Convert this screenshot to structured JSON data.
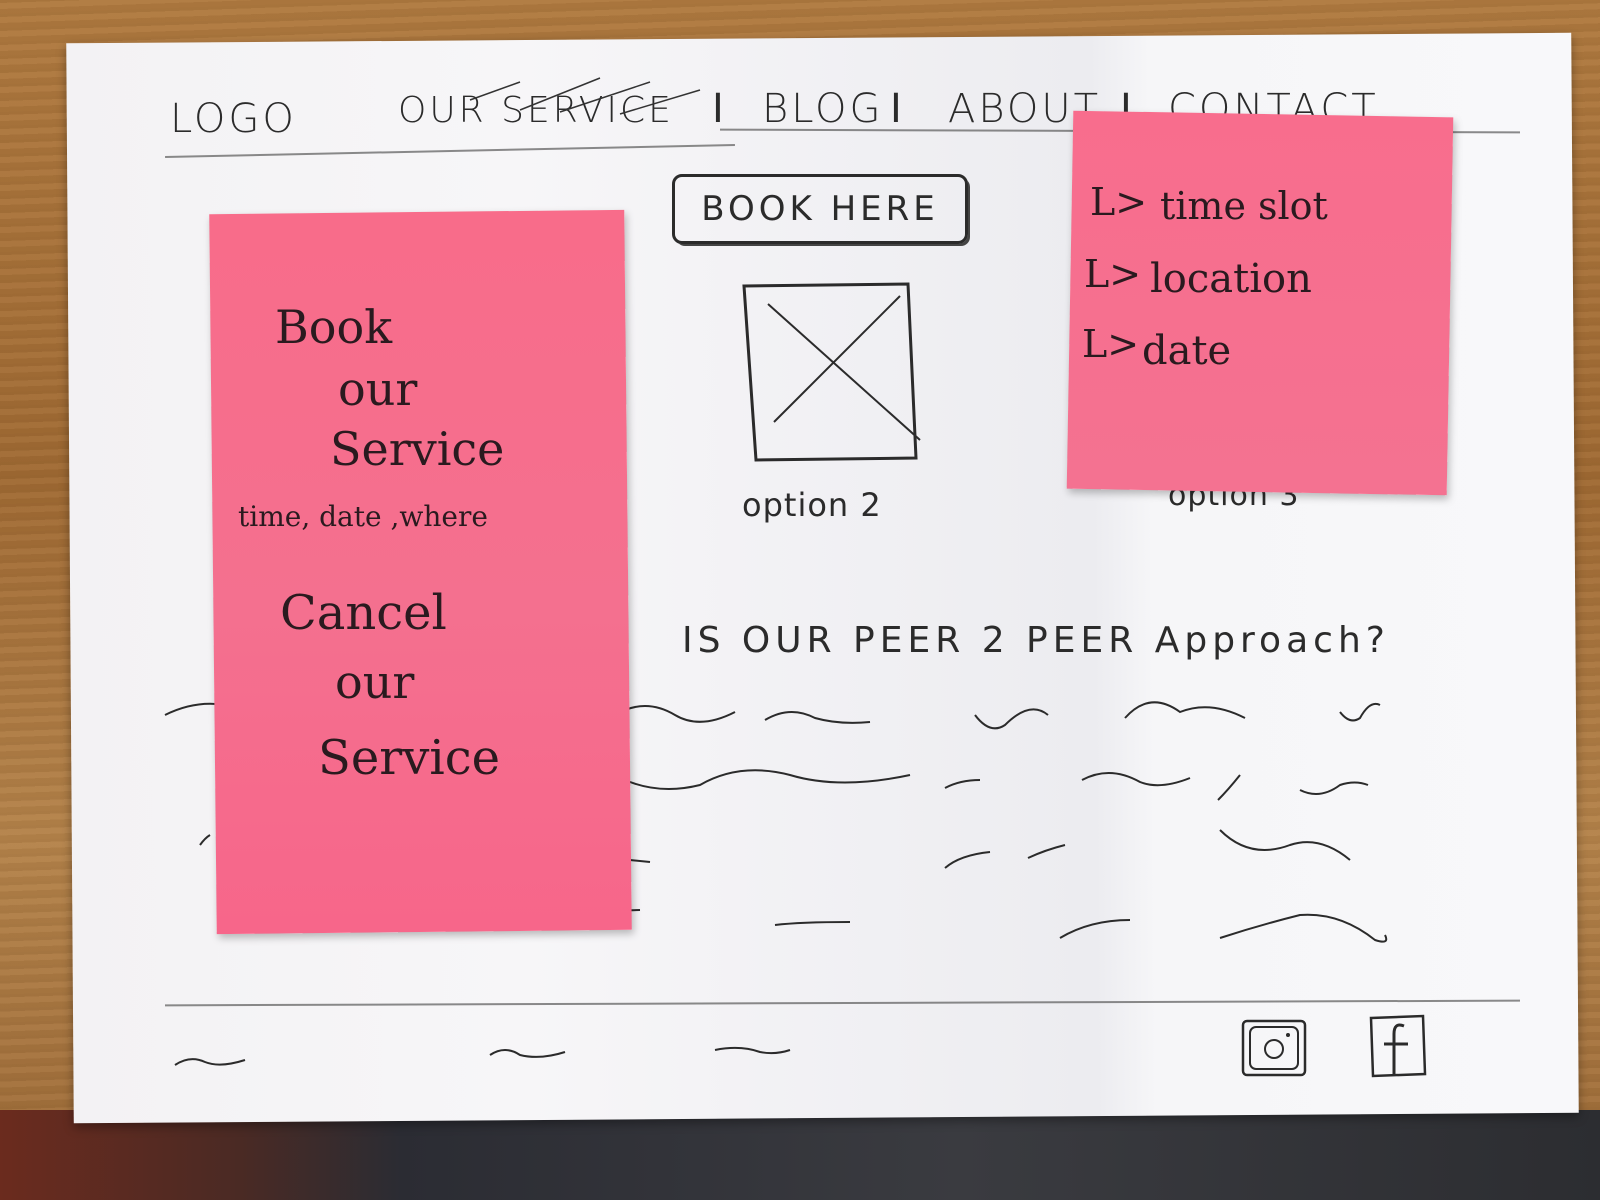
{
  "header": {
    "logo": "LOGO",
    "nav": [
      {
        "label": "OUR SERVICE"
      },
      {
        "label": "BLOG"
      },
      {
        "label": "ABOUT"
      },
      {
        "label": "CONTACT"
      }
    ],
    "separator": "I"
  },
  "hero": {
    "book_button": "BOOK HERE",
    "option2_label": "option 2",
    "option3_label": "option 3"
  },
  "sticky_left": {
    "line1": "Book",
    "line2": "our",
    "line3": "Service",
    "subline": "time, date ,where",
    "line4": "Cancel",
    "line5": "our",
    "line6": "Service"
  },
  "sticky_right": {
    "items": [
      {
        "arrow": "L>",
        "text": "time slot"
      },
      {
        "arrow": "L>",
        "text": "location"
      },
      {
        "arrow": "L>",
        "text": "date"
      }
    ]
  },
  "body_text": {
    "question": "IS OUR PEER 2 PEER Approach?"
  },
  "footer": {
    "icons": [
      "instagram-icon",
      "facebook-icon"
    ]
  },
  "colors": {
    "sticky_pink": "#f6708c",
    "ink": "#2b2b2b",
    "paper": "#f6f6f8"
  }
}
